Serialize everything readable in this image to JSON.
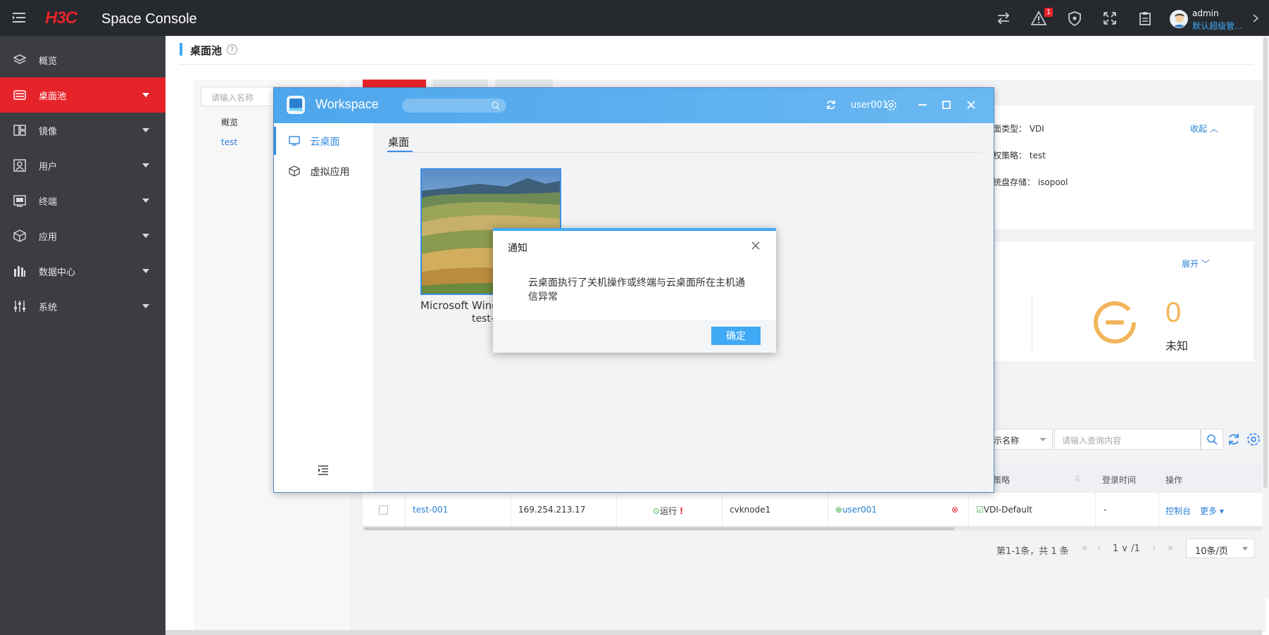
{
  "topbar": {
    "logo": "H3C",
    "product": "Space Console",
    "alert_badge": "1",
    "user_name": "admin",
    "user_role": "默认超级管..."
  },
  "sidebar": {
    "items": [
      {
        "label": "概览",
        "icon": "layers-icon"
      },
      {
        "label": "桌面池",
        "icon": "desktop-pool-icon"
      },
      {
        "label": "镜像",
        "icon": "image-icon"
      },
      {
        "label": "用户",
        "icon": "user-icon"
      },
      {
        "label": "终端",
        "icon": "terminal-icon"
      },
      {
        "label": "应用",
        "icon": "app-cube-icon"
      },
      {
        "label": "数据中心",
        "icon": "datacenter-icon"
      },
      {
        "label": "系统",
        "icon": "settings-sliders-icon"
      }
    ],
    "active_index": 1
  },
  "page": {
    "title": "桌面池",
    "tree_search_placeholder": "请输入名称",
    "tree_nodes": [
      "概览",
      "test"
    ]
  },
  "detail": {
    "type_label": "面类型：",
    "type_value": "VDI",
    "auth_label": "权策略：",
    "auth_value": "test",
    "storage_label": "统盘存储：",
    "storage_value": "isopool",
    "collapse": "收起"
  },
  "stats": {
    "expand": "展开",
    "unknown_count": "0",
    "unknown_label": "未知"
  },
  "filter": {
    "select_value": "示名称",
    "query_placeholder": "请输入查询内容"
  },
  "table": {
    "headers": {
      "policy": "策略",
      "login_time": "登录时间",
      "action": "操作"
    },
    "row": {
      "name": "test-001",
      "ip": "169.254.213.17",
      "status": "运行",
      "warn": "!",
      "host": "cvknode1",
      "user": "user001",
      "policy": "VDI-Default",
      "login_time": "-",
      "console": "控制台",
      "more": "更多"
    }
  },
  "pager": {
    "info": "第1-1条，共 1 条",
    "page": "1",
    "total": "/1",
    "size": "10条/页"
  },
  "workspace": {
    "title": "Workspace",
    "user": "user001",
    "nav": [
      "云桌面",
      "虚拟应用"
    ],
    "tab": "桌面",
    "desktop_name": "Microsoft Wind",
    "desktop_sub": "test-"
  },
  "dialog": {
    "title": "通知",
    "message": "云桌面执行了关机操作或终端与云桌面所在主机通信异常",
    "ok": "确定"
  },
  "colors": {
    "brand_red": "#e7232a",
    "accent_blue": "#3fa9f5",
    "sidebar_bg": "#3b3d42",
    "topbar_bg": "#26292e",
    "unknown_orange": "#f2b55b"
  }
}
